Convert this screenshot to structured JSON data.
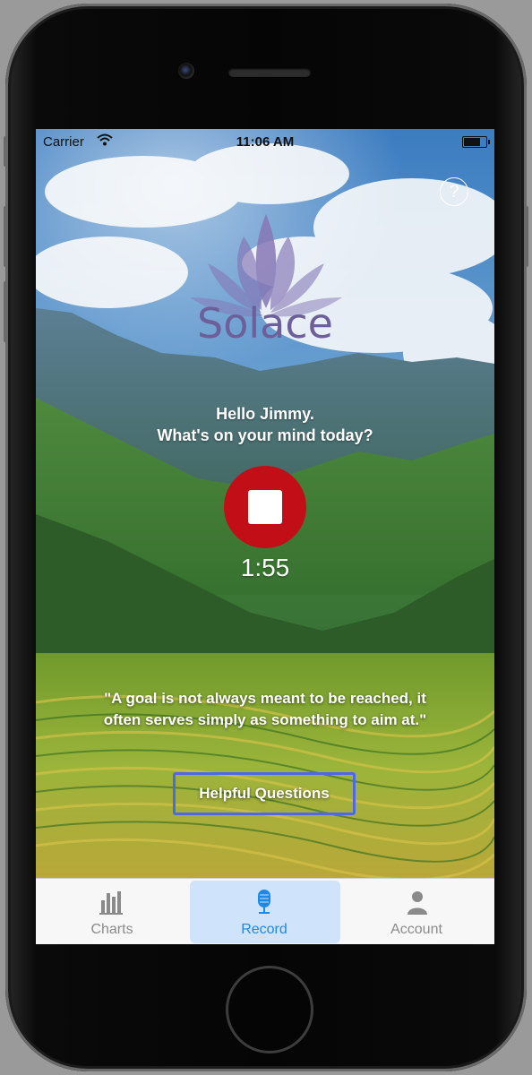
{
  "status_bar": {
    "carrier": "Carrier",
    "time": "11:06 AM"
  },
  "help_icon": "question-circle-icon",
  "app": {
    "name": "Solace"
  },
  "greeting": {
    "line1": "Hello Jimmy.",
    "line2": "What's on your mind today?"
  },
  "recorder": {
    "timer": "1:55",
    "stop_icon": "stop-icon",
    "button_color": "#c20e17"
  },
  "quote": {
    "line1": "\"A goal is not always meant to be reached, it",
    "line2": "often serves simply as something to aim at.\""
  },
  "helpful_questions_label": "Helpful Questions",
  "tabs": [
    {
      "label": "Charts",
      "icon": "bar-chart-icon",
      "active": false
    },
    {
      "label": "Record",
      "icon": "microphone-icon",
      "active": true
    },
    {
      "label": "Account",
      "icon": "person-icon",
      "active": false
    }
  ],
  "colors": {
    "accent": "#1e88e5",
    "active_tab_bg": "#cfe3fb",
    "logo": "#6c5f9a",
    "button_border": "#4f69e6"
  }
}
